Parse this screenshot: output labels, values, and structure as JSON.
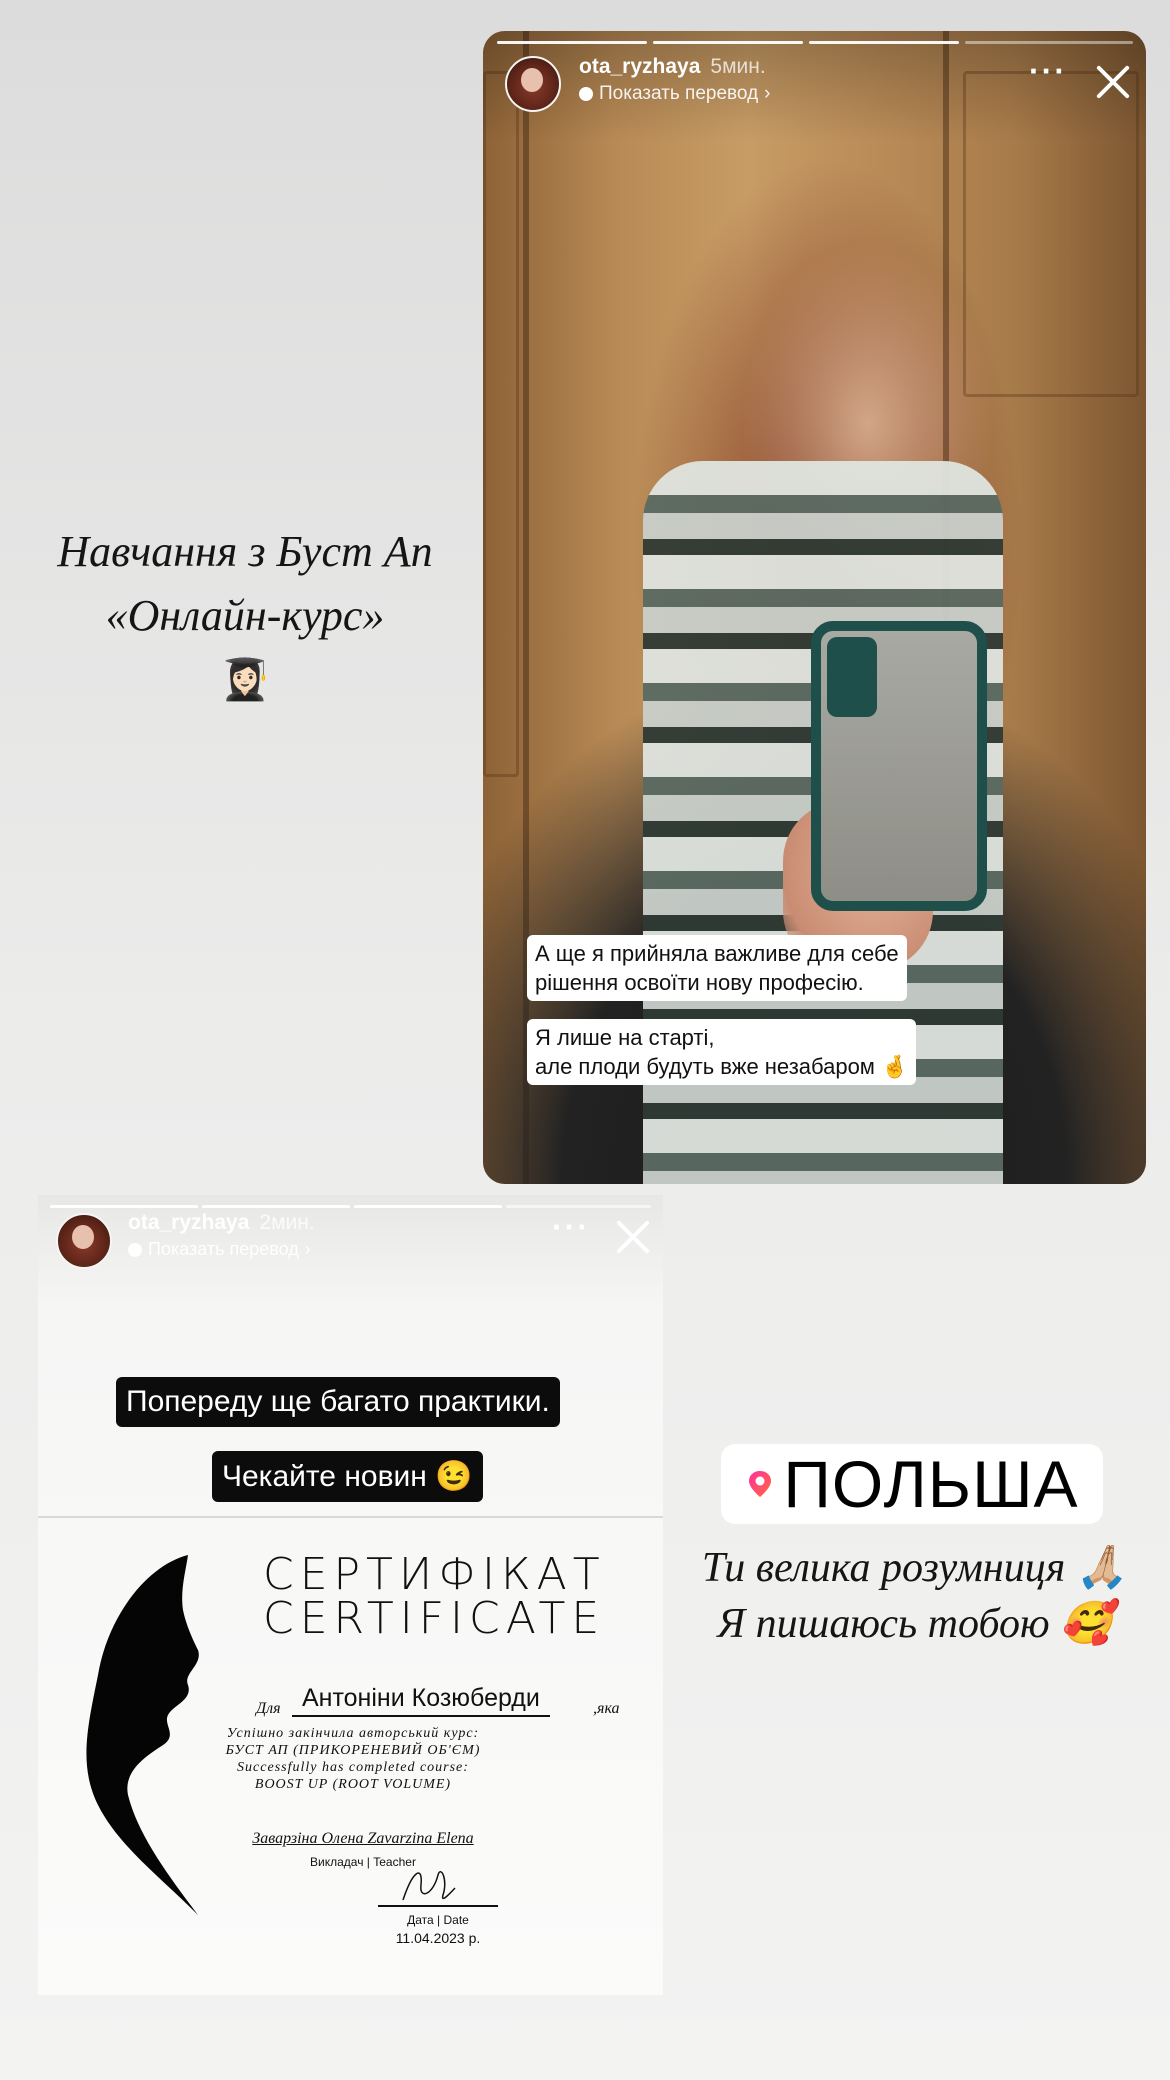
{
  "left_caption": {
    "line1": "Навчання з Буст Ап",
    "line2": "«Онлайн-курс»",
    "emoji": "👩🏻‍🎓"
  },
  "story_top": {
    "username": "ota_ryzhaya",
    "time": "5мин.",
    "translate_label": "Показать перевод",
    "more_icon": "ellipsis-icon",
    "close_icon": "close-icon",
    "sticker1": "А ще я прийняла важливе для себе\nрішення освоїти нову професію.",
    "sticker2": "Я лише на старті,\nале плоди будуть вже незабаром 🤞"
  },
  "story_bottom": {
    "username": "ota_ryzhaya",
    "time": "2мин.",
    "translate_label": "Показать перевод",
    "caption1": "Попереду ще багато практики.",
    "caption2": "Чекайте новин 😉",
    "certificate": {
      "title_ua": "СЕРТИФІКАТ",
      "title_en": "CERTIFICATE",
      "for_label": "Для",
      "recipient": "Антоніни Козюберди",
      "which_label": ",яка",
      "line1": "Успішно закінчила авторський курс:",
      "line2": "БУСТ АП (ПРИКОРЕНЕВИЙ ОБ'ЄМ)",
      "line3": "Successfully has completed course:",
      "line4": "BOOST UP (ROOT VOLUME)",
      "teacher_name": "Заварзіна Олена Zavarzina Elena",
      "teacher_label": "Викладач | Teacher",
      "date_label": "Дата | Date",
      "date_value": "11.04.2023 р."
    }
  },
  "location_sticker": {
    "label": "ПОЛЬША",
    "icon": "location-pin-icon"
  },
  "right_caption": {
    "line1": "Ти велика розумниця 🙏🏼",
    "line2": "Я пишаюсь тобою 🥰"
  },
  "colors": {
    "background": "#e6e6e5",
    "sticker_bg": "#ffffff",
    "pill_bg": "#0c0c0c",
    "pin_gradient": [
      "#ff2fa0",
      "#ff6a3c"
    ]
  }
}
